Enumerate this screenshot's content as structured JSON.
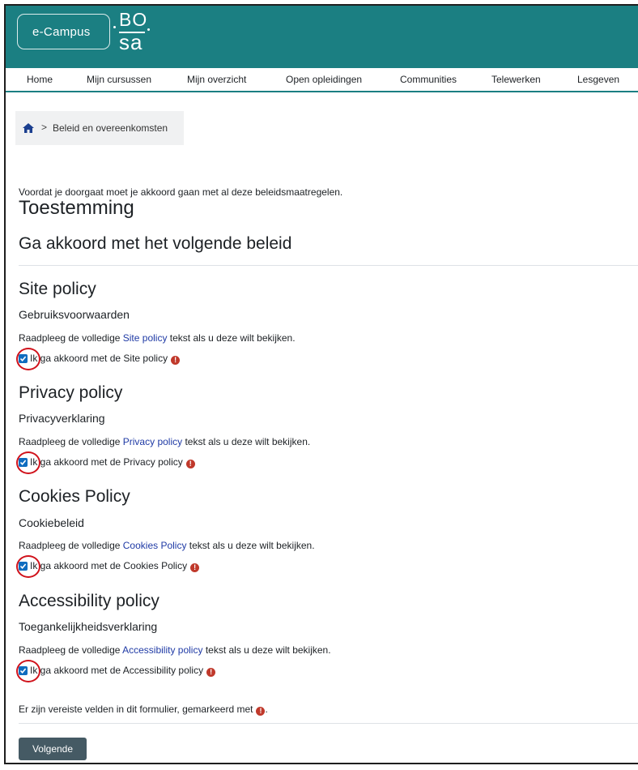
{
  "header": {
    "brand_label": "e-Campus",
    "logo_top": "BO",
    "logo_bottom": "sa",
    "color_teal": "#1b7f82"
  },
  "nav": {
    "items": [
      {
        "label": "Home"
      },
      {
        "label": "Mijn cursussen"
      },
      {
        "label": "Mijn overzicht"
      },
      {
        "label": "Open opleidingen"
      },
      {
        "label": "Communities"
      },
      {
        "label": "Telewerken"
      },
      {
        "label": "Lesgeven"
      }
    ]
  },
  "breadcrumb": {
    "icon": "home-icon",
    "separator": ">",
    "current": "Beleid en overeenkomsten"
  },
  "main": {
    "intro": "Voordat je doorgaat moet je akkoord gaan met al deze beleidsmaatregelen.",
    "title": "Toestemming",
    "subtitle": "Ga akkoord met het volgende beleid"
  },
  "policies": [
    {
      "title": "Site policy",
      "subtitle": "Gebruiksvoorwaarden",
      "read_prefix": "Raadpleeg de volledige ",
      "link": "Site policy",
      "read_suffix": " tekst als u deze wilt bekijken.",
      "checkbox_label": "Ik ga akkoord met de Site policy",
      "checked": true
    },
    {
      "title": "Privacy policy",
      "subtitle": "Privacyverklaring",
      "read_prefix": "Raadpleeg de volledige ",
      "link": "Privacy policy",
      "read_suffix": " tekst als u deze wilt bekijken.",
      "checkbox_label": "Ik ga akkoord met de Privacy policy",
      "checked": true
    },
    {
      "title": "Cookies Policy",
      "subtitle": "Cookiebeleid",
      "read_prefix": "Raadpleeg de volledige ",
      "link": "Cookies Policy",
      "read_suffix": " tekst als u deze wilt bekijken.",
      "checkbox_label": "Ik ga akkoord met de Cookies Policy",
      "checked": true
    },
    {
      "title": "Accessibility policy",
      "subtitle": "Toegankelijkheidsverklaring",
      "read_prefix": "Raadpleeg de volledige ",
      "link": "Accessibility policy",
      "read_suffix": " tekst als u deze wilt bekijken.",
      "checkbox_label": "Ik ga akkoord met de Accessibility policy",
      "checked": true
    }
  ],
  "required_icon_glyph": "!",
  "footer": {
    "required_note": "Er zijn vereiste velden in dit formulier, gemarkeerd met",
    "required_note_end": ".",
    "next_button": "Volgende"
  },
  "colors": {
    "link": "#1f3aa5",
    "checkbox": "#0f6cbf",
    "required": "#c0392b",
    "annotation_circle": "#d0121b",
    "button": "#455a64"
  }
}
